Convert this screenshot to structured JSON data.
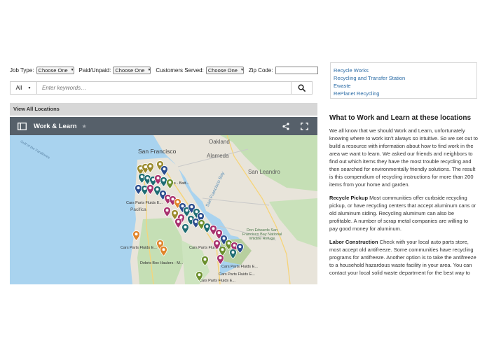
{
  "filters": {
    "job_type_label": "Job Type:",
    "job_type_value": "Choose One",
    "paid_label": "Paid/Unpaid:",
    "paid_value": "Choose One",
    "customers_label": "Customers Served:",
    "customers_value": "Choose One",
    "zip_label": "Zip Code:",
    "zip_value": ""
  },
  "search": {
    "category_value": "All",
    "placeholder": "Enter keywords…",
    "search_icon": "search-icon"
  },
  "map_section": {
    "view_all_label": "View All Locations",
    "map_title": "Work & Learn",
    "icons": [
      "layers-icon",
      "star-icon",
      "share-icon",
      "fullscreen-icon"
    ]
  },
  "map_labels": {
    "san_francisco": "San Francisco",
    "oakland": "Oakland",
    "alameda": "Alameda",
    "san_leandro": "San Leandro",
    "pacifica": "Pacifica",
    "gulf": "Gulf of the Farallones",
    "bay": "San Francisco Bay",
    "park": "Don Edwards San Francisco Bay National Wildlife Refuge",
    "pin_label_1": "Cars Parts Fluids E...",
    "pin_label_2": "Debris Box Haulers - M...",
    "pin_label_3": "Cars Parts Fluids E...",
    "pin_label_4": "Cars Parts Fluids E...",
    "pin_label_5": "Cars Parts Fluids E...",
    "pin_label_6": "Cars Parts Fluids E...",
    "pin_label_7": "Cars Parts Fluids E...",
    "pin_label_8": "Batteries - Batt..."
  },
  "sidebar_links": [
    {
      "label": "Recycle Works"
    },
    {
      "label": "Recycling and Transfer Station"
    },
    {
      "label": "Ewaste"
    },
    {
      "label": "RePlanet Recycling"
    }
  ],
  "article": {
    "heading": "What to Work and Learn at these locations",
    "intro": "We all know that we should Work and Learn, unfortunately knowing where to work isn't always so intuitive. So we set out to build a resource with information about how to find work in the area we want to learn. We asked our friends and neighbors to find out which items they have the most trouble recycling and then searched for environmentally friendly solutions. The result is this compendium of recycling instructions for more than 200 items from your home and garden.",
    "section1_title": "Recycle Pickup",
    "section1_body": " Most communities offer curbside recycling pickup, or have recycling centers that accept aluminum cans or old aluminum siding. Recycling aluminum can also be profitable. A number of scrap metal companies are willing to pay good money for aluminum.",
    "section2_title": "Labor Construction",
    "section2_body": " Check with your local auto parts store, most accept old antifreeze. Some communities have recycling programs for antifreeze. Another option is to take the antifreeze to a household hazardous waste facility in your area. You can contact your local solid waste department for the best way to"
  },
  "colors": {
    "map_header": "#56606a",
    "link": "#2a6ba5",
    "water": "#a9d3ef",
    "land": "#e8e4da",
    "pin_green": "#6b8f2d",
    "pin_teal": "#1f6d73",
    "pin_magenta": "#a8316e",
    "pin_blue": "#2b4d8e",
    "pin_orange": "#e0842a",
    "pin_olive": "#9a8a2c"
  }
}
